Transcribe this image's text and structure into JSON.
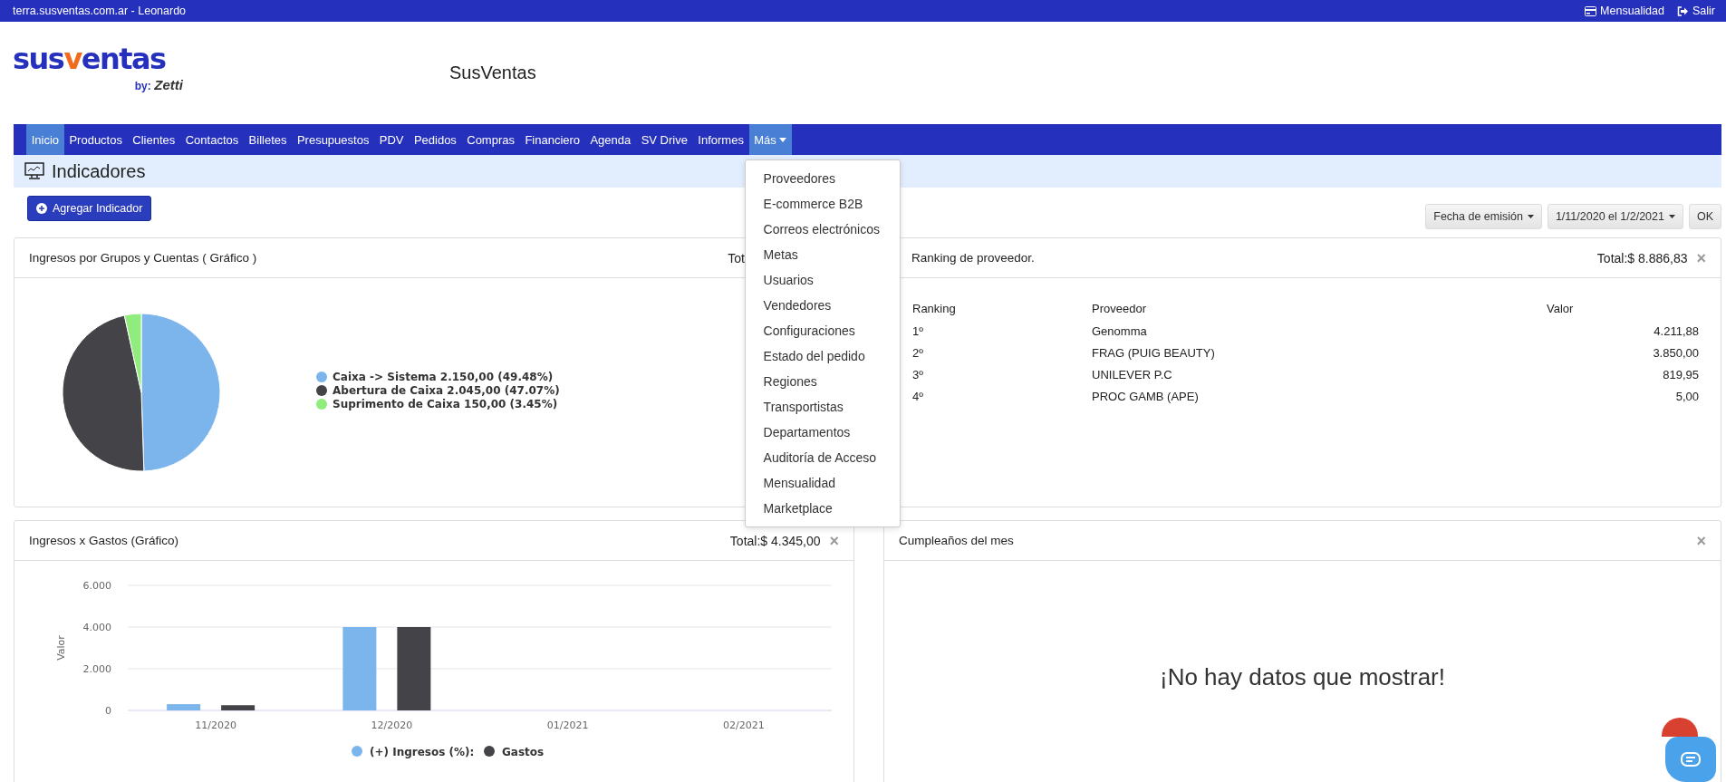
{
  "top_bar": {
    "site": "terra.susventas.com.ar - Leonardo",
    "links": [
      {
        "label": "Mensualidad",
        "kind": "card"
      },
      {
        "label": "Salir",
        "kind": "exit"
      }
    ]
  },
  "logo": {
    "parts": [
      {
        "text": "sus",
        "kind": "main"
      },
      {
        "text": "v",
        "kind": "accent"
      },
      {
        "text": "entas",
        "kind": "main"
      }
    ],
    "by": "by:",
    "brand": "Zetti"
  },
  "app_title": "SusVentas",
  "nav": {
    "items": [
      {
        "label": "Inicio",
        "selected": true
      },
      {
        "label": "Productos",
        "selected": false
      },
      {
        "label": "Clientes",
        "selected": false
      },
      {
        "label": "Contactos",
        "selected": false
      },
      {
        "label": "Billetes",
        "selected": false
      },
      {
        "label": "Presupuestos",
        "selected": false
      },
      {
        "label": "PDV",
        "selected": false
      },
      {
        "label": "Pedidos",
        "selected": false
      },
      {
        "label": "Compras",
        "selected": false
      },
      {
        "label": "Financiero",
        "selected": false
      },
      {
        "label": "Agenda",
        "selected": false
      },
      {
        "label": "SV Drive",
        "selected": false
      },
      {
        "label": "Informes",
        "selected": false
      }
    ],
    "more": {
      "label": "Más",
      "expanded": true,
      "items": [
        "Proveedores",
        "E-commerce B2B",
        "Correos electrónicos",
        "Metas",
        "Usuarios",
        "Vendedores",
        "Configuraciones",
        "Estado del pedido",
        "Regiones",
        "Transportistas",
        "Departamentos",
        "Auditoría de Acceso",
        "Mensualidad",
        "Marketplace"
      ]
    }
  },
  "page_title": "Indicadores",
  "add_button": "Agregar Indicador",
  "filters": {
    "date_type": "Fecha de emisión",
    "range": "1/11/2020 el 1/2/2021",
    "ok": "OK"
  },
  "income_pie": {
    "title": "Ingresos por Grupos y Cuentas ( Gráfico )",
    "total": "Tot",
    "chart_data": {
      "type": "pie",
      "legend": "right",
      "categories": [
        "Caixa -> Sistema 2.150,00 (49.48%)",
        "Abertura de Caixa 2.045,00 (47.07%)",
        "Suprimento de Caixa 150,00 (3.45%)"
      ],
      "values": [
        49.48,
        47.07,
        3.45
      ],
      "colors": [
        "#7cb5ec",
        "#434348",
        "#90ed7d"
      ]
    }
  },
  "ranking": {
    "title": "Ranking de proveedor.",
    "total": "Total:$ 8.886,83",
    "close": "×",
    "columns": [
      "Ranking",
      "Proveedor",
      "Valor"
    ],
    "rows": [
      {
        "rank": "1º",
        "name": "Genomma",
        "value": "4.211,88"
      },
      {
        "rank": "2º",
        "name": "FRAG (PUIG BEAUTY)",
        "value": "3.850,00"
      },
      {
        "rank": "3º",
        "name": "UNILEVER P.C",
        "value": "819,95"
      },
      {
        "rank": "4º",
        "name": "PROC GAMB (APE)",
        "value": "5,00"
      }
    ]
  },
  "income_expense": {
    "title": "Ingresos x Gastos (Gráfico)",
    "total": "Total:$ 4.345,00",
    "close": "×",
    "chart_data": {
      "type": "bar",
      "legend": "bottom",
      "ylabel": "Valor",
      "categories": [
        "11/2020",
        "12/2020",
        "01/2021",
        "02/2021"
      ],
      "ylim": [
        0,
        6000
      ],
      "yticks": [
        {
          "value": 0,
          "label": "0"
        },
        {
          "value": 2000,
          "label": "2.000"
        },
        {
          "value": 4000,
          "label": "4.000"
        },
        {
          "value": 6000,
          "label": "6.000"
        }
      ],
      "series": [
        {
          "name": "(+) Ingresos (%):",
          "color": "#7cb5ec",
          "values": [
            300,
            4000,
            0,
            0
          ]
        },
        {
          "name": "Gastos",
          "color": "#434348",
          "values": [
            250,
            4000,
            0,
            0
          ]
        }
      ]
    }
  },
  "birthdays": {
    "title": "Cumpleaños del mes",
    "close": "×",
    "empty": "¡No hay datos que mostrar!"
  }
}
